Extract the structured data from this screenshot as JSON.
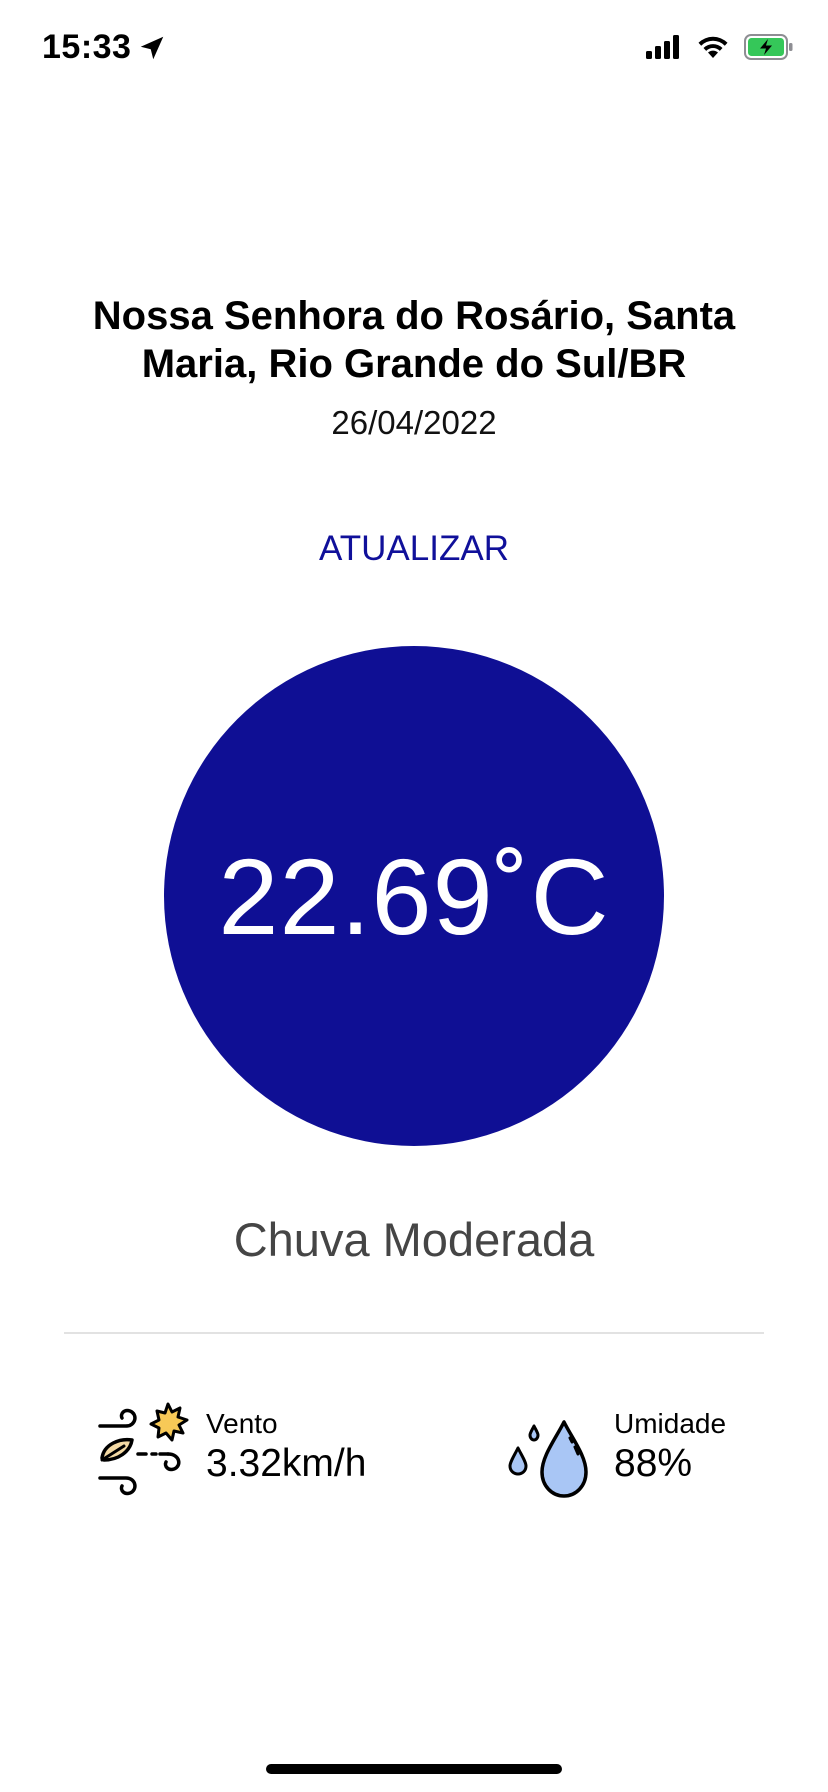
{
  "status_bar": {
    "time": "15:33",
    "icons": [
      "location-arrow-icon",
      "cellular-signal-icon",
      "wifi-icon",
      "battery-charging-icon"
    ],
    "battery_color": "#35c759"
  },
  "header": {
    "location": "Nossa Senhora do Rosário, Santa Maria, Rio Grande do Sul/BR",
    "date": "26/04/2022"
  },
  "actions": {
    "refresh_label": "ATUALIZAR"
  },
  "weather": {
    "temperature": "22.69˚C",
    "condition": "Chuva Moderada",
    "circle_color": "#0f0f94",
    "accent_color": "#10109a"
  },
  "metrics": {
    "wind": {
      "icon": "wind-icon",
      "label": "Vento",
      "value": "3.32km/h"
    },
    "humidity": {
      "icon": "water-drop-icon",
      "label": "Umidade",
      "value": "88%"
    }
  }
}
